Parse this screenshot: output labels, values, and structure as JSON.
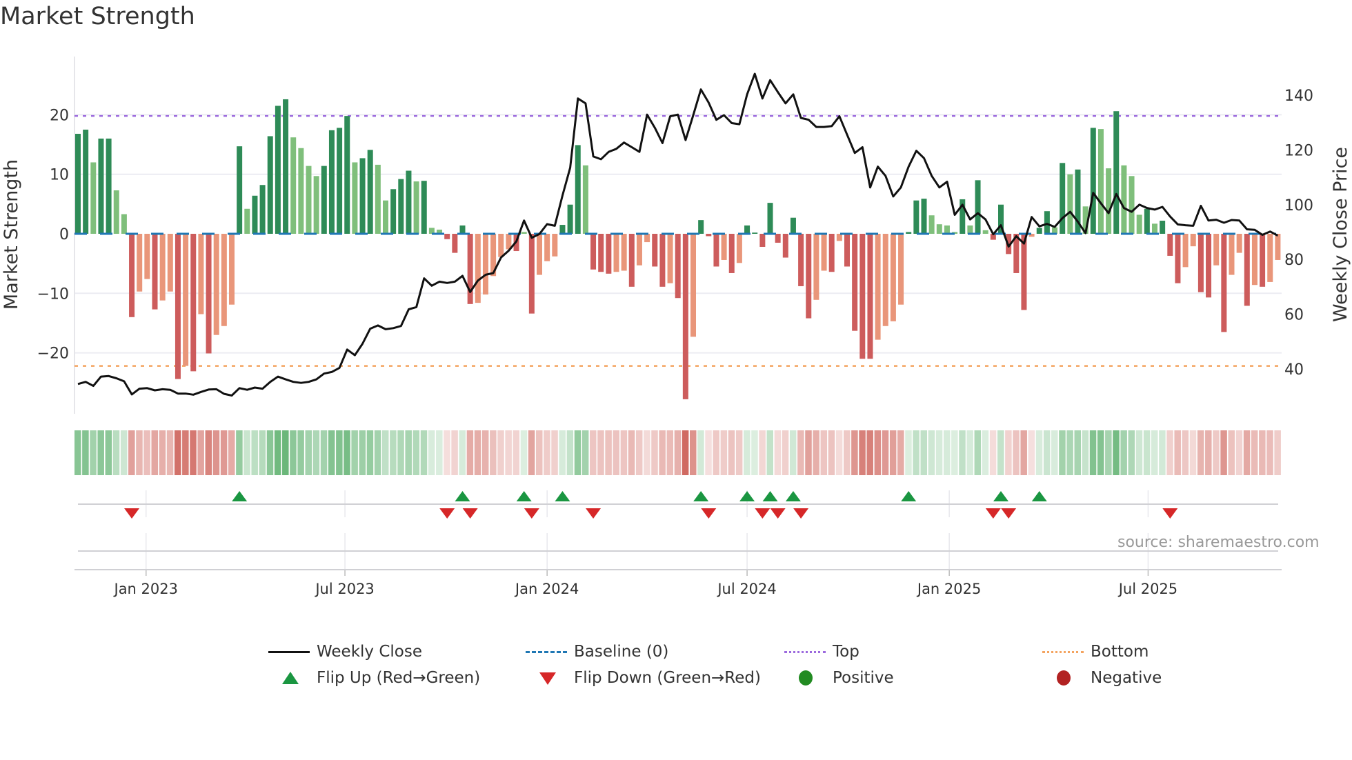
{
  "title": "Market Strength",
  "source": "source: sharemaestro.com",
  "colors": {
    "green_strong": "#2e8b57",
    "green_light": "#7fbf7b",
    "red_strong": "#cd5c5c",
    "red_light": "#e9967a",
    "price": "#111111",
    "baseline": "#1f77b4",
    "top": "#9c6ade",
    "bottom": "#f4a460",
    "flip_up": "#1a9641",
    "flip_down": "#d62728",
    "positive": "#228b22",
    "negative": "#b22222"
  },
  "legend": [
    {
      "label": "Weekly Close",
      "icon": "solid-line"
    },
    {
      "label": "Baseline (0)",
      "icon": "dashed-line"
    },
    {
      "label": "Top",
      "icon": "dotted-line-purple"
    },
    {
      "label": "Bottom",
      "icon": "dotted-line-orange"
    },
    {
      "label": "Flip Up (Red→Green)",
      "icon": "triangle-up"
    },
    {
      "label": "Flip Down (Green→Red)",
      "icon": "triangle-down"
    },
    {
      "label": "Positive",
      "icon": "green-dot"
    },
    {
      "label": "Negative",
      "icon": "red-dot"
    }
  ],
  "chart_data": {
    "type": "bar",
    "title": "Market Strength",
    "ylabel": "Market Strength",
    "y2label": "Weekly Close Price",
    "ylim": [
      -29.5,
      29.5
    ],
    "y2lim": [
      27,
      157
    ],
    "yticks": [
      20,
      10,
      0,
      -10,
      -20
    ],
    "ytick_labels": [
      "20",
      "10",
      "0",
      "−10",
      "−20"
    ],
    "y2ticks": [
      140,
      120,
      100,
      80,
      60,
      40
    ],
    "y2tick_labels": [
      "140",
      "120",
      "100",
      "80",
      "60",
      "40"
    ],
    "xticks": [
      {
        "date": "2023-01-01",
        "label": "Jan 2023"
      },
      {
        "date": "2023-07-01",
        "label": "Jul 2023"
      },
      {
        "date": "2024-01-01",
        "label": "Jan 2024"
      },
      {
        "date": "2024-07-01",
        "label": "Jul 2024"
      },
      {
        "date": "2025-01-01",
        "label": "Jan 2025"
      },
      {
        "date": "2025-07-01",
        "label": "Jul 2025"
      }
    ],
    "x_start": "2022-10-31",
    "x_interval": "weekly",
    "top_threshold": 19.8,
    "bottom_threshold": -22.2,
    "baseline": 0,
    "strength": [
      16.8,
      17.5,
      12.0,
      16.0,
      16.0,
      7.3,
      3.3,
      -14.0,
      -9.7,
      -7.6,
      -12.7,
      -11.2,
      -9.7,
      -24.4,
      -22.2,
      -23.1,
      -13.5,
      -20.1,
      -17.0,
      -15.5,
      -11.9,
      14.7,
      4.2,
      6.4,
      8.2,
      16.4,
      21.5,
      22.6,
      16.2,
      14.4,
      11.4,
      9.7,
      11.4,
      17.4,
      17.8,
      19.8,
      12.0,
      12.7,
      14.1,
      11.6,
      5.6,
      7.5,
      9.2,
      10.6,
      8.8,
      8.9,
      1.0,
      0.7,
      -0.9,
      -3.2,
      1.4,
      -11.8,
      -11.6,
      -10.2,
      -7.1,
      -3.9,
      -2.6,
      -2.9,
      0.3,
      -13.4,
      -6.9,
      -4.6,
      -3.8,
      1.5,
      4.9,
      14.9,
      11.5,
      -6.0,
      -6.4,
      -6.7,
      -6.4,
      -6.2,
      -8.9,
      -5.3,
      -1.4,
      -5.5,
      -8.9,
      -8.3,
      -10.8,
      -27.8,
      -17.3,
      2.3,
      -0.4,
      -5.5,
      -4.4,
      -6.6,
      -4.9,
      1.4,
      0.2,
      -2.2,
      5.2,
      -1.5,
      -4.0,
      2.7,
      -8.8,
      -14.2,
      -11.1,
      -6.2,
      -6.4,
      -1.2,
      -5.5,
      -16.3,
      -21.0,
      -21.0,
      -17.8,
      -15.5,
      -14.7,
      -11.9,
      0.3,
      5.6,
      5.9,
      3.1,
      1.6,
      1.4,
      0.3,
      5.8,
      1.4,
      9.0,
      0.6,
      -1.0,
      4.9,
      -3.4,
      -6.6,
      -12.8,
      -0.5,
      1.0,
      3.8,
      1.1,
      11.9,
      10.0,
      10.8,
      4.6,
      17.8,
      17.6,
      11.0,
      20.6,
      11.5,
      9.7,
      3.2,
      4.2,
      1.7,
      2.2,
      -3.7,
      -8.3,
      -5.6,
      -2.1,
      -9.8,
      -10.7,
      -5.3,
      -16.5,
      -6.9,
      -3.2,
      -12.1,
      -8.6,
      -8.9,
      -8.1,
      -4.4
    ],
    "shade": "DDLDDLLDLLDLLDLDLDLLLDLDDDDDLLLLDDDDLDDLLDDDLDLLDDDDLLLLLDLDLLLDDDLDDDLLDLLDDLDDLDDDLDLDDDDDDDDDLLDLDDDDLLLLDDDLLLLDLDLDDDDDLDDLDLDLDLLDLLLDLDDDLLDDLDLLDLDLL",
    "weekly_close": [
      34.5,
      35.3,
      33.8,
      37.2,
      37.4,
      36.6,
      35.5,
      30.7,
      32.8,
      33.0,
      32.2,
      32.6,
      32.4,
      31.0,
      31.0,
      30.6,
      31.6,
      32.5,
      32.6,
      30.9,
      30.3,
      33.0,
      32.4,
      33.2,
      32.8,
      35.3,
      37.2,
      36.2,
      35.3,
      34.9,
      35.3,
      36.2,
      38.3,
      38.9,
      40.4,
      47.1,
      45.0,
      49.2,
      54.7,
      55.9,
      54.5,
      54.9,
      55.7,
      61.8,
      62.6,
      73.1,
      70.4,
      71.9,
      71.4,
      71.9,
      74.0,
      68.1,
      72.3,
      74.4,
      75.0,
      80.7,
      83.2,
      86.6,
      94.2,
      87.9,
      89.3,
      92.9,
      92.3,
      103.4,
      113.5,
      138.8,
      137.0,
      117.6,
      116.6,
      119.3,
      120.4,
      122.7,
      121.0,
      119.3,
      132.9,
      128.1,
      122.5,
      132.3,
      132.9,
      123.6,
      132.7,
      142.1,
      137.3,
      131.0,
      132.7,
      129.8,
      129.4,
      140.3,
      147.8,
      138.8,
      145.5,
      141.1,
      137.0,
      140.3,
      131.7,
      131.0,
      128.4,
      128.4,
      128.7,
      132.3,
      125.6,
      118.9,
      121.0,
      106.3,
      113.9,
      110.5,
      103.0,
      106.3,
      113.9,
      119.7,
      117.0,
      110.5,
      106.3,
      108.4,
      96.3,
      100.0,
      94.6,
      96.9,
      94.6,
      89.2,
      92.5,
      84.7,
      88.5,
      85.8,
      95.5,
      92.1,
      93.0,
      91.9,
      95.1,
      97.4,
      93.8,
      89.6,
      104.3,
      100.5,
      96.9,
      103.9,
      98.8,
      97.4,
      100.0,
      98.8,
      98.2,
      99.2,
      95.7,
      92.8,
      92.5,
      92.3,
      99.6,
      94.2,
      94.5,
      93.4,
      94.4,
      94.2,
      91.0,
      90.8,
      89.0,
      90.2,
      88.7
    ],
    "flip_up_indices": [
      21,
      50,
      58,
      63,
      81,
      87,
      90,
      93,
      108,
      120,
      125
    ],
    "flip_down_indices": [
      7,
      48,
      51,
      59,
      67,
      82,
      89,
      91,
      94,
      119,
      121,
      142
    ],
    "grid": true
  }
}
